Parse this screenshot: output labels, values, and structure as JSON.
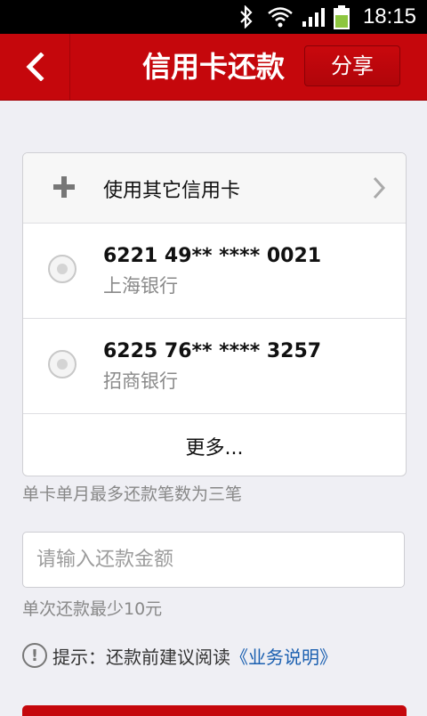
{
  "status_bar": {
    "time": "18:15"
  },
  "header": {
    "title": "信用卡还款",
    "share_label": "分享"
  },
  "card_list": {
    "other_card_label": "使用其它信用卡",
    "cards": [
      {
        "number": "6221 49** **** 0021",
        "bank": "上海银行"
      },
      {
        "number": "6225 76** **** 3257",
        "bank": "招商银行"
      }
    ],
    "more_label": "更多..."
  },
  "hint_limit": "单卡单月最多还款笔数为三笔",
  "amount": {
    "placeholder": "请输入还款金额",
    "value": ""
  },
  "hint_min": "单次还款最少10元",
  "tip": {
    "prefix": "提示：还款前建议阅读",
    "link": "《业务说明》"
  },
  "colors": {
    "brand_red": "#c5070c",
    "link_blue": "#1a5fb0"
  }
}
